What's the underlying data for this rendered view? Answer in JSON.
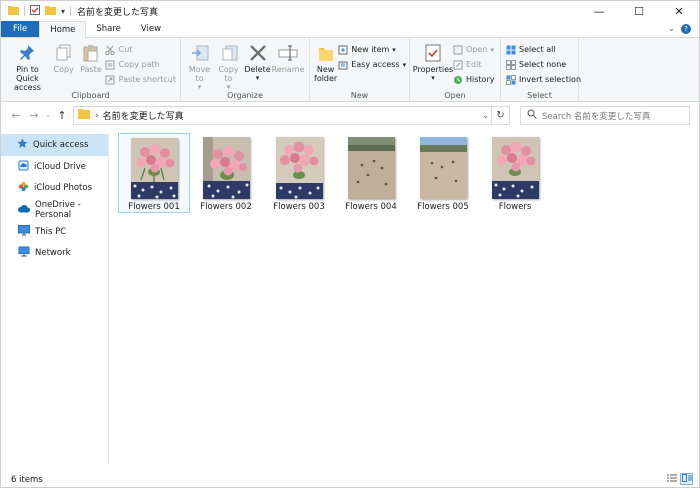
{
  "window": {
    "title": "名前を変更した写真",
    "controls": {
      "minimize": "—",
      "maximize": "☐",
      "close": "✕"
    }
  },
  "tabs": [
    {
      "label": "File"
    },
    {
      "label": "Home"
    },
    {
      "label": "Share"
    },
    {
      "label": "View"
    }
  ],
  "ribbon": {
    "clipboard": {
      "label": "Clipboard",
      "pin": "Pin to Quick access",
      "copy": "Copy",
      "paste": "Paste",
      "cut": "Cut",
      "copy_path": "Copy path",
      "paste_shortcut": "Paste shortcut"
    },
    "organize": {
      "label": "Organize",
      "move_to": "Move to",
      "copy_to": "Copy to",
      "delete": "Delete",
      "rename": "Rename"
    },
    "new": {
      "label": "New",
      "new_folder": "New folder",
      "new_item": "New item",
      "easy_access": "Easy access"
    },
    "open": {
      "label": "Open",
      "properties": "Properties",
      "open": "Open",
      "edit": "Edit",
      "history": "History"
    },
    "select": {
      "label": "Select",
      "select_all": "Select all",
      "select_none": "Select none",
      "invert_selection": "Invert selection"
    }
  },
  "address": {
    "path": "名前を変更した写真",
    "search_placeholder": "Search 名前を変更した写真"
  },
  "sidebar": {
    "items": [
      {
        "label": "Quick access"
      },
      {
        "label": "iCloud Drive"
      },
      {
        "label": "iCloud Photos"
      },
      {
        "label": "OneDrive - Personal"
      },
      {
        "label": "This PC"
      },
      {
        "label": "Network"
      }
    ]
  },
  "files": [
    {
      "name": "Flowers 001"
    },
    {
      "name": "Flowers 002"
    },
    {
      "name": "Flowers 003"
    },
    {
      "name": "Flowers 004"
    },
    {
      "name": "Flowers 005"
    },
    {
      "name": "Flowers"
    }
  ],
  "status": {
    "count": "6 items"
  },
  "colors": {
    "accent": "#1e6bb8",
    "selection": "#cce4f7",
    "folder": "#f4c542"
  }
}
